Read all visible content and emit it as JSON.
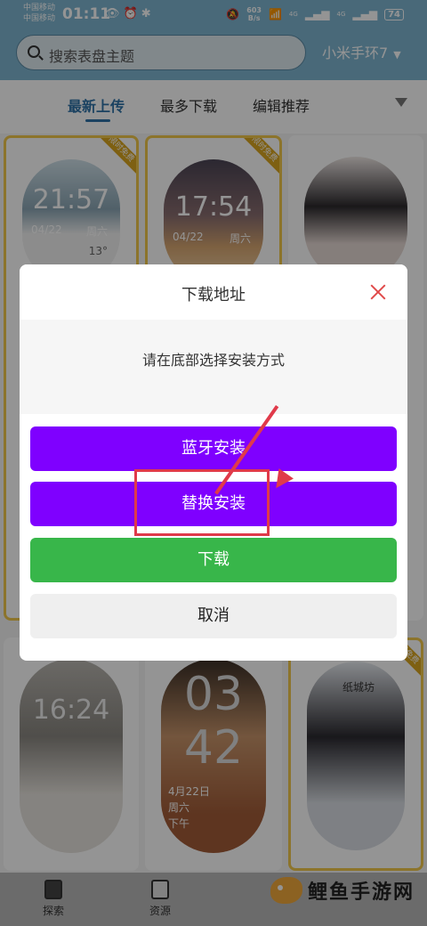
{
  "status_bar": {
    "carrier1": "中国移动",
    "carrier2": "中国移动",
    "time": "01:11",
    "net_speed_value": "603",
    "net_speed_unit": "B/s",
    "signal_label1": "4G",
    "signal_label2": "4G",
    "battery": "74"
  },
  "search": {
    "placeholder": "搜索表盘主题",
    "device": "小米手环7"
  },
  "tabs": [
    "最新上传",
    "最多下载",
    "编辑推荐"
  ],
  "cards": [
    {
      "ribbon": "限时免费",
      "time": "21:57",
      "date": "04/22",
      "weekday": "周六",
      "temp": "13°"
    },
    {
      "ribbon": "限时免费",
      "time": "17:54",
      "date": "04/22",
      "weekday": "周六"
    },
    {
      "ribbon": ""
    },
    {
      "time": "16:24"
    },
    {
      "time1": "03",
      "time2": "42",
      "date": "4月22日",
      "weekday": "周六",
      "ampm": "下午"
    },
    {
      "ribbon": "限时免费",
      "caption": "纸城坊"
    }
  ],
  "bottom_nav": [
    "探索",
    "资源"
  ],
  "watermark": "鲤鱼手游网",
  "dialog": {
    "title": "下载地址",
    "message": "请在底部选择安装方式",
    "btn_bluetooth": "蓝牙安装",
    "btn_replace": "替换安装",
    "btn_download": "下载",
    "btn_cancel": "取消"
  },
  "colors": {
    "purple": "#7f00ff",
    "green": "#38b64a",
    "annotation_red": "#e03a4a",
    "tab_active": "#2f73a8"
  }
}
